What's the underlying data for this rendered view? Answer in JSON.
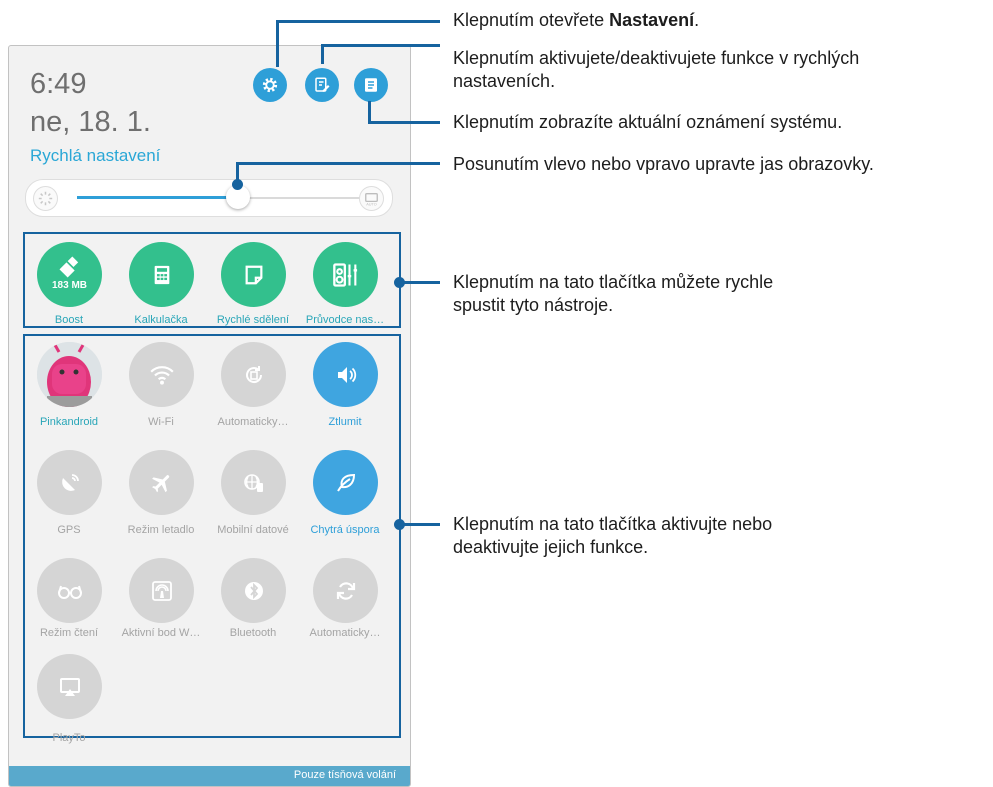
{
  "status": {
    "time": "6:49",
    "date": "ne, 18. 1.",
    "section_label": "Rychlá nastavení"
  },
  "brightness": {
    "level_fraction": 0.56,
    "auto_label": "AUTO"
  },
  "header_icons": [
    "settings-gear-icon",
    "edit-quick-settings-icon",
    "notification-list-icon"
  ],
  "quick_tools": [
    {
      "label": "Boost",
      "badge": "183 MB",
      "icon": "broom-icon"
    },
    {
      "label": "Kalkulačka",
      "icon": "calculator-icon"
    },
    {
      "label": "Rychlé sdělení",
      "icon": "note-icon"
    },
    {
      "label": "Průvodce nas…",
      "icon": "equalizer-icon"
    }
  ],
  "toggles": [
    {
      "label": "Pinkandroid",
      "state": "user",
      "icon": "avatar"
    },
    {
      "label": "Wi-Fi",
      "state": "off",
      "icon": "wifi-icon"
    },
    {
      "label": "Automaticky…",
      "state": "off",
      "icon": "auto-rotate-icon"
    },
    {
      "label": "Ztlumit",
      "state": "on",
      "icon": "volume-icon"
    },
    {
      "label": "GPS",
      "state": "off",
      "icon": "gps-icon"
    },
    {
      "label": "Režim letadlo",
      "state": "off",
      "icon": "airplane-icon"
    },
    {
      "label": "Mobilní datové",
      "state": "off",
      "icon": "mobile-data-icon"
    },
    {
      "label": "Chytrá úspora",
      "state": "on",
      "icon": "leaf-icon"
    },
    {
      "label": "Režim čtení",
      "state": "off",
      "icon": "glasses-icon"
    },
    {
      "label": "Aktivní bod W…",
      "state": "off",
      "icon": "hotspot-icon"
    },
    {
      "label": "Bluetooth",
      "state": "off",
      "icon": "bluetooth-icon"
    },
    {
      "label": "Automaticky…",
      "state": "off",
      "icon": "sync-icon"
    },
    {
      "label": "PlayTo",
      "state": "off",
      "icon": "playto-icon"
    }
  ],
  "bottom_bar": {
    "text": "Pouze tísňová volání"
  },
  "annotations": {
    "settings": {
      "before": "Klepnutím otevřete ",
      "bold": "Nastavení",
      "after": "."
    },
    "edit": [
      "Klepnutím aktivujete/deaktivujete funkce v rychlých",
      "nastaveních."
    ],
    "notifications": "Klepnutím zobrazíte aktuální oznámení systému.",
    "brightness": "Posunutím vlevo nebo vpravo upravte jas obrazovky.",
    "tools": [
      "Klepnutím na tato tlačítka můžete rychle",
      "spustit tyto nástroje."
    ],
    "toggles": [
      "Klepnutím na tato tlačítka aktivujte nebo",
      "deaktivujte jejich funkce."
    ]
  },
  "colors": {
    "accent_blue": "#2e9fd8",
    "tool_green": "#33c08d",
    "toggle_off": "#d5d5d5",
    "callout": "#16639f"
  }
}
